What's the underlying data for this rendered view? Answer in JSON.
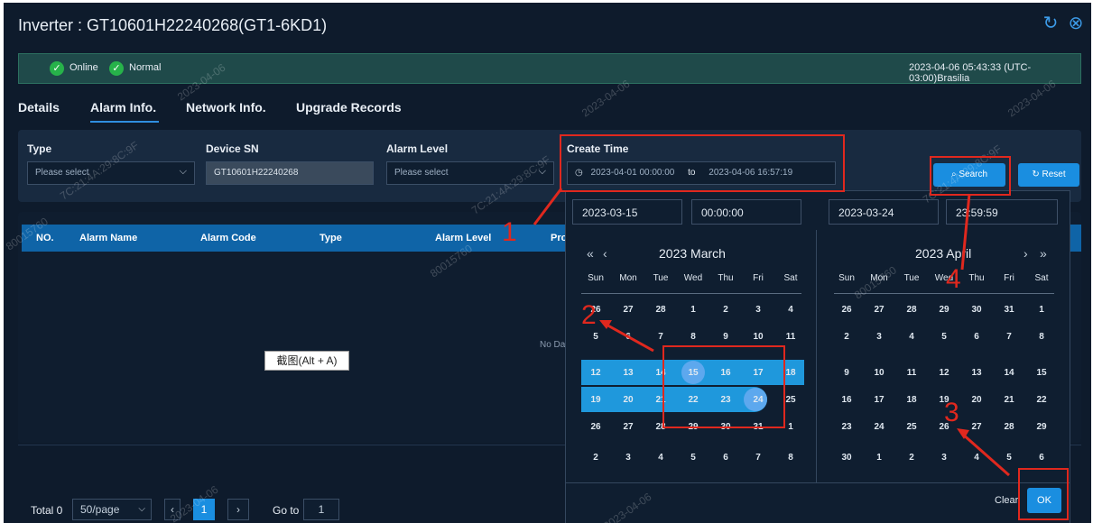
{
  "header": {
    "label": "Inverter :",
    "device": "GT10601H22240268(GT1-6KD1)",
    "refresh_icon": "refresh-icon",
    "close_icon": "close-circle-icon"
  },
  "status": {
    "online": "Online",
    "normal": "Normal",
    "datetime": "2023-04-06 05:43:33 (UTC-03:00)Brasilia"
  },
  "tabs": [
    "Details",
    "Alarm Info.",
    "Network Info.",
    "Upgrade Records"
  ],
  "filters": {
    "type_label": "Type",
    "type_placeholder": "Please select",
    "sn_label": "Device SN",
    "sn_value": "GT10601H22240268",
    "level_label": "Alarm Level",
    "level_placeholder": "Please select",
    "time_label": "Create Time",
    "time_start": "2023-04-01 00:00:00",
    "time_to": "to",
    "time_end": "2023-04-06 16:57:19",
    "search": "Search",
    "reset": "Reset"
  },
  "table": {
    "columns": [
      "NO.",
      "Alarm Name",
      "Alarm Code",
      "Type",
      "Alarm Level",
      "Pro"
    ],
    "empty": "No Da"
  },
  "footer": {
    "total": "Total 0",
    "page_size": "50/page",
    "current_page": "1",
    "goto_label": "Go to",
    "goto_value": "1"
  },
  "tooltip": "截图(Alt + A)",
  "picker": {
    "left_date": "2023-03-15",
    "left_time": "00:00:00",
    "right_date": "2023-03-24",
    "right_time": "23:59:59",
    "left_title": "2023 March",
    "right_title": "2023 April",
    "weekdays": [
      "Sun",
      "Mon",
      "Tue",
      "Wed",
      "Thu",
      "Fri",
      "Sat"
    ],
    "march_weeks": [
      [
        "26",
        "27",
        "28",
        "1",
        "2",
        "3",
        "4"
      ],
      [
        "5",
        "6",
        "7",
        "8",
        "9",
        "10",
        "11"
      ],
      [
        "12",
        "13",
        "14",
        "15",
        "16",
        "17",
        "18"
      ],
      [
        "19",
        "20",
        "21",
        "22",
        "23",
        "24",
        "25"
      ],
      [
        "26",
        "27",
        "28",
        "29",
        "30",
        "31",
        "1"
      ],
      [
        "2",
        "3",
        "4",
        "5",
        "6",
        "7",
        "8"
      ]
    ],
    "april_weeks": [
      [
        "26",
        "27",
        "28",
        "29",
        "30",
        "31",
        "1"
      ],
      [
        "2",
        "3",
        "4",
        "5",
        "6",
        "7",
        "8"
      ],
      [
        "9",
        "10",
        "11",
        "12",
        "13",
        "14",
        "15"
      ],
      [
        "16",
        "17",
        "18",
        "19",
        "20",
        "21",
        "22"
      ],
      [
        "23",
        "24",
        "25",
        "26",
        "27",
        "28",
        "29"
      ],
      [
        "30",
        "1",
        "2",
        "3",
        "4",
        "5",
        "6"
      ]
    ],
    "clear": "Clear",
    "ok": "OK"
  },
  "annotations": [
    "1",
    "2",
    "3",
    "4"
  ],
  "watermarks": [
    "2023-04-06",
    "7C:21:4A:29:8C:9F",
    "80015760"
  ],
  "colors": {
    "accent": "#1f98dc",
    "annotation": "#e0281e",
    "online": "#27b24a"
  }
}
